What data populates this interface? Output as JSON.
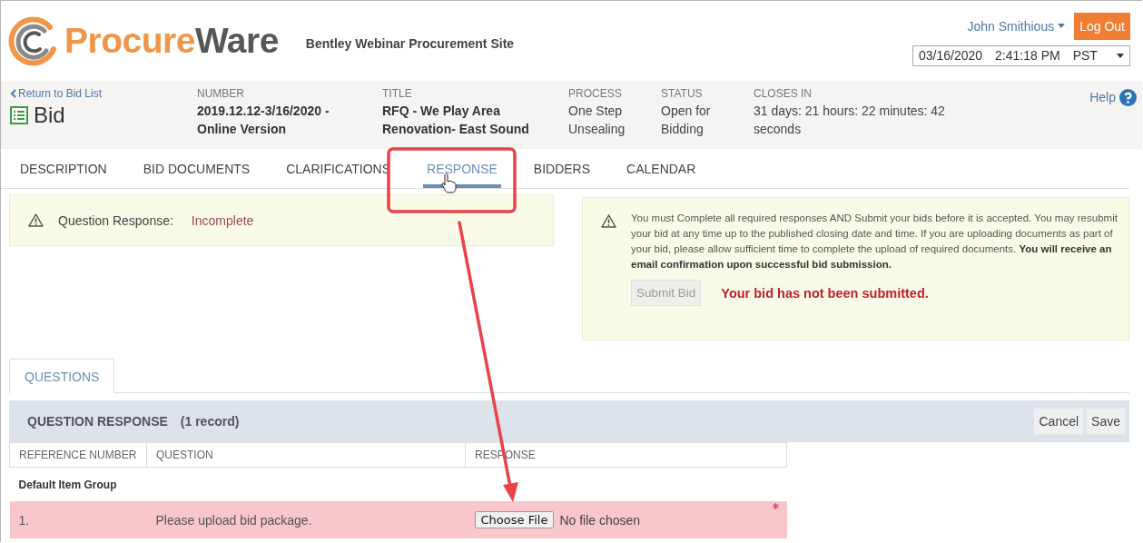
{
  "header": {
    "logo": {
      "part_1": "Procure",
      "part_2": "Ware"
    },
    "site_title": "Bentley Webinar Procurement Site",
    "user_menu": "John Smithious",
    "logout_button": "Log Out",
    "datetime": {
      "date": "03/16/2020",
      "time": "2:41:18 PM",
      "zone": "PST"
    }
  },
  "bid_header": {
    "back_link": "Return to Bid List",
    "page_title": "Bid",
    "help_link": "Help",
    "fields": [
      {
        "label": "NUMBER",
        "value": "2019.12.12-3/16/2020 - Online Version",
        "bold": true
      },
      {
        "label": "TITLE",
        "value": "RFQ - We Play Area Renovation- East Sound",
        "bold": true
      },
      {
        "label": "PROCESS",
        "value": "One Step Unsealing",
        "bold": false
      },
      {
        "label": "STATUS",
        "value": "Open for Bidding",
        "bold": false
      },
      {
        "label": "CLOSES IN",
        "value": "31 days: 21 hours: 22 minutes: 42 seconds",
        "bold": false
      }
    ]
  },
  "tabs": [
    {
      "label": "DESCRIPTION",
      "selected": false
    },
    {
      "label": "BID DOCUMENTS",
      "selected": false
    },
    {
      "label": "CLARIFICATIONS",
      "selected": false
    },
    {
      "label": "RESPONSE",
      "selected": true
    },
    {
      "label": "BIDDERS",
      "selected": false
    },
    {
      "label": "CALENDAR",
      "selected": false
    }
  ],
  "status_alert": {
    "label": "Question Response:",
    "value": "Incomplete"
  },
  "submit_notice": {
    "message": "You must Complete all required responses AND Submit your bids before it is accepted. You may resubmit your bid at any time up to the published closing date and time. If you are uploading documents as part of your bid, please allow sufficient time to complete the upload of required documents. **You will receive an email confirmation upon successful bid submission.**",
    "submit_button": {
      "label": "Submit Bid",
      "disabled": true
    },
    "status": "Your bid has not been submitted."
  },
  "subtabs": [
    {
      "label": "QUESTIONS",
      "selected": true
    }
  ],
  "question_response": {
    "title": "QUESTION RESPONSE",
    "count": "(1 record)",
    "buttons": [
      "Cancel",
      "Save"
    ],
    "columns": [
      "REFERENCE NUMBER",
      "QUESTION",
      "RESPONSE"
    ],
    "groups": [
      {
        "name": "Default Item Group",
        "rows": [
          {
            "reference": "1.",
            "question": "Please upload bid package.",
            "response": {
              "button": "Choose File",
              "file": "No file chosen"
            },
            "required": true
          }
        ]
      }
    ]
  }
}
